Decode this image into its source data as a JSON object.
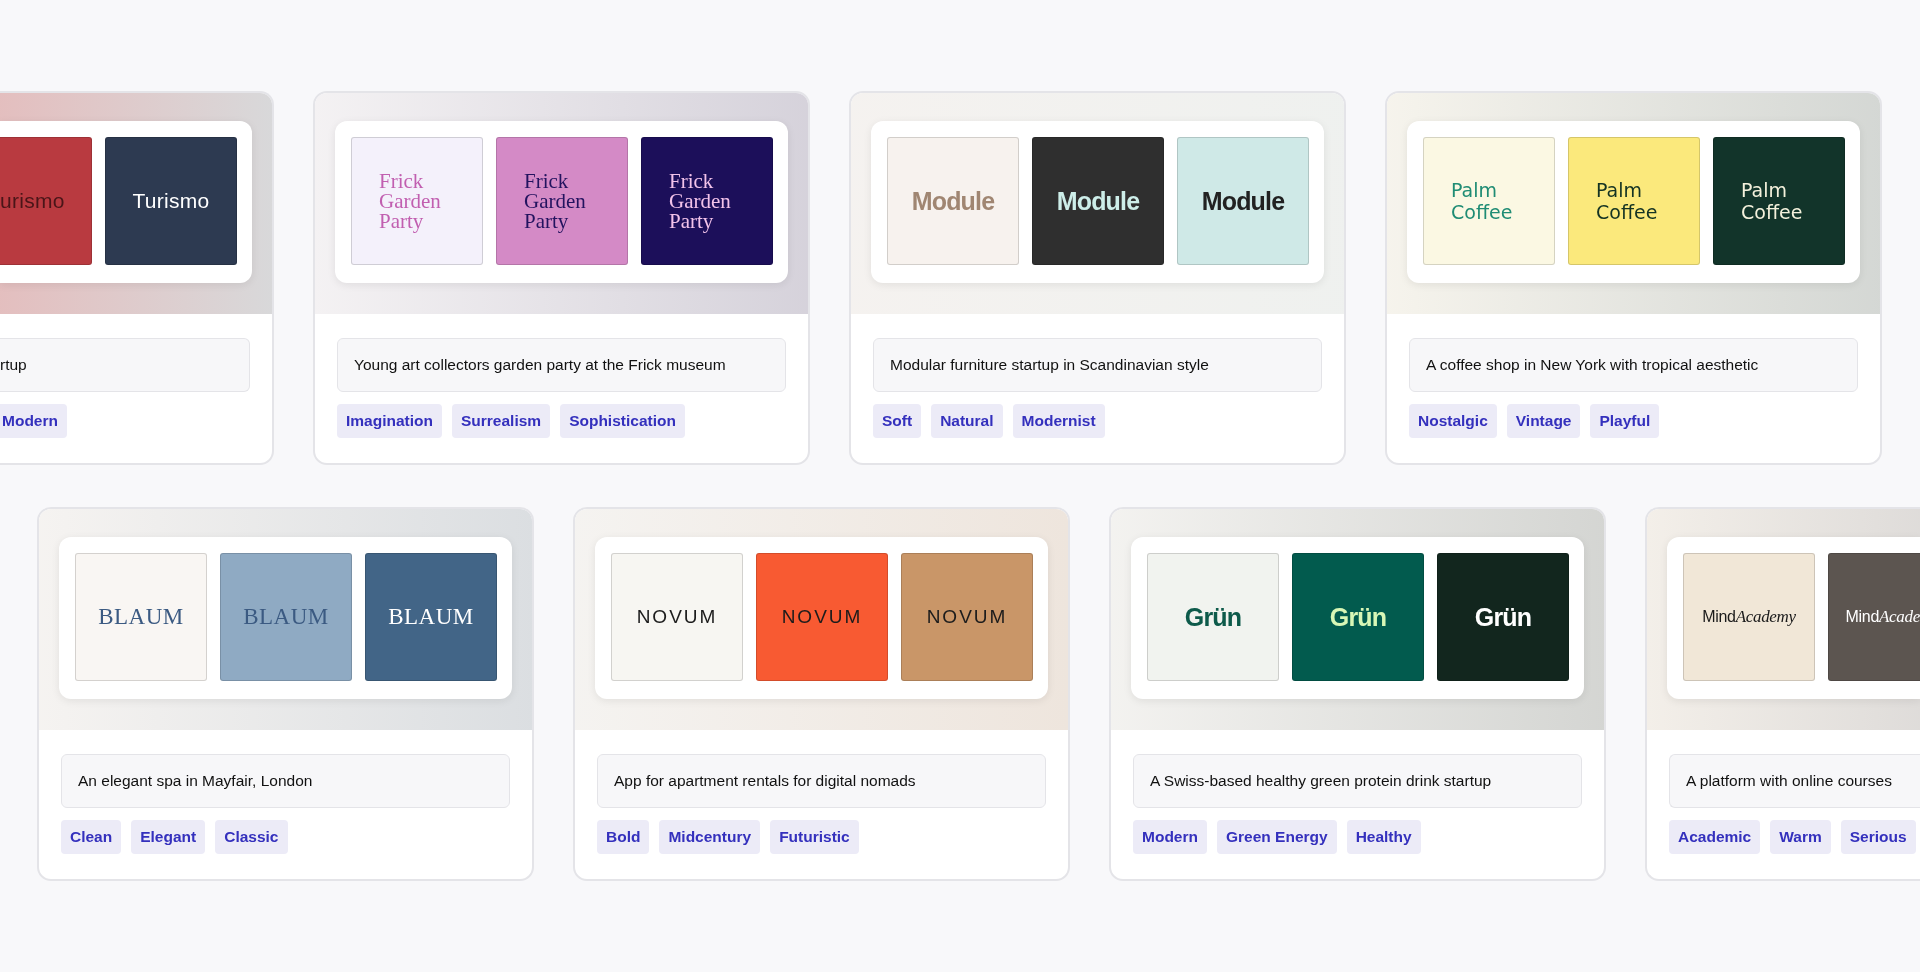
{
  "rows": [
    {
      "cards": [
        {
          "kind": "cut-left",
          "swatches": [
            {
              "color": "#b93a40",
              "logo": {
                "kind": "sans",
                "label": "urismo",
                "color": "#4a1518"
              }
            },
            {
              "color": "#2d3a51",
              "logo": {
                "kind": "sans",
                "label": "Turismo",
                "color": "#ffffff"
              }
            }
          ],
          "description": "rtup",
          "tags": [
            "Modern"
          ]
        },
        {
          "kind": "full",
          "swatches": [
            {
              "color": "#f4f1fb",
              "logo": {
                "kind": "serif",
                "label": "Frick Garden Party",
                "color": "#c15fb0"
              }
            },
            {
              "color": "#d48ac6",
              "logo": {
                "kind": "serif",
                "label": "Frick Garden Party",
                "color": "#23135f"
              }
            },
            {
              "color": "#1c0f5a",
              "logo": {
                "kind": "serif",
                "label": "Frick Garden Party",
                "color": "#f2c3ea"
              }
            }
          ],
          "description": "Young art collectors garden party at the Frick museum",
          "tags": [
            "Imagination",
            "Surrealism",
            "Sophistication"
          ]
        },
        {
          "kind": "full",
          "swatches": [
            {
              "color": "#f7f2ee",
              "logo": {
                "kind": "bold",
                "label": "Module",
                "color": "#a08672"
              }
            },
            {
              "color": "#2f2f2f",
              "logo": {
                "kind": "bold",
                "label": "Module",
                "color": "#cdeee9"
              }
            },
            {
              "color": "#cfe9e7",
              "logo": {
                "kind": "bold",
                "label": "Module",
                "color": "#222222"
              }
            }
          ],
          "description": "Modular furniture startup in Scandinavian style",
          "tags": [
            "Soft",
            "Natural",
            "Modernist"
          ]
        },
        {
          "kind": "full",
          "swatches": [
            {
              "color": "#fbf8e3",
              "logo": {
                "kind": "rounded",
                "label": "Palm Coffee",
                "color": "#1f8c74"
              }
            },
            {
              "color": "#fbe97c",
              "logo": {
                "kind": "rounded",
                "label": "Palm Coffee",
                "color": "#143323"
              }
            },
            {
              "color": "#12342a",
              "logo": {
                "kind": "rounded",
                "label": "Palm Coffee",
                "color": "#f4f1dc"
              }
            }
          ],
          "description": "A coffee shop in New York with tropical aesthetic",
          "tags": [
            "Nostalgic",
            "Vintage",
            "Playful"
          ]
        }
      ]
    },
    {
      "cards": [
        {
          "kind": "full",
          "swatches": [
            {
              "color": "#f9f6f3",
              "logo": {
                "kind": "caps-serif",
                "label": "BLAUM",
                "color": "#3b5a82"
              }
            },
            {
              "color": "#8faac3",
              "logo": {
                "kind": "caps-serif",
                "label": "BLAUM",
                "color": "#3b5a82"
              }
            },
            {
              "color": "#426587",
              "logo": {
                "kind": "caps-serif",
                "label": "BLAUM",
                "color": "#ffffff"
              }
            }
          ],
          "description": "An elegant spa in Mayfair, London",
          "tags": [
            "Clean",
            "Elegant",
            "Classic"
          ]
        },
        {
          "kind": "full",
          "swatches": [
            {
              "color": "#f7f6f2",
              "logo": {
                "kind": "geometric",
                "label": "NOVUM",
                "color": "#1c1c1c"
              }
            },
            {
              "color": "#f85a32",
              "logo": {
                "kind": "geometric",
                "label": "NOVUM",
                "color": "#1c1c1c"
              }
            },
            {
              "color": "#c99668",
              "logo": {
                "kind": "geometric",
                "label": "NOVUM",
                "color": "#1c1c1c"
              }
            }
          ],
          "description": "App for apartment rentals for digital nomads",
          "tags": [
            "Bold",
            "Midcentury",
            "Futuristic"
          ]
        },
        {
          "kind": "full",
          "swatches": [
            {
              "color": "#f1f3ef",
              "logo": {
                "kind": "bold",
                "label": "Grün",
                "color": "#0d5a4a"
              }
            },
            {
              "color": "#025b4e",
              "logo": {
                "kind": "bold",
                "label": "Grün",
                "color": "#d8f7b6"
              }
            },
            {
              "color": "#12261e",
              "logo": {
                "kind": "bold",
                "label": "Grün",
                "color": "#ffffff"
              }
            }
          ],
          "description": "A Swiss-based healthy green protein drink startup",
          "tags": [
            "Modern",
            "Green Energy",
            "Healthy"
          ]
        },
        {
          "kind": "cut-right",
          "swatches": [
            {
              "color": "#f1e7d7",
              "logo": {
                "kind": "mixed",
                "parts": [
                  {
                    "text": "Mind",
                    "italic": false
                  },
                  {
                    "text": "Academy",
                    "italic": true
                  }
                ],
                "color": "#1a1a1a"
              }
            },
            {
              "color": "#5c5550",
              "logo": {
                "kind": "mixed",
                "parts": [
                  {
                    "text": "Mind",
                    "italic": false
                  },
                  {
                    "text": "Acade",
                    "italic": true
                  }
                ],
                "color": "#ffffff"
              }
            }
          ],
          "description": "A platform with online courses",
          "tags": [
            "Academic",
            "Warm",
            "Serious"
          ]
        }
      ]
    }
  ]
}
